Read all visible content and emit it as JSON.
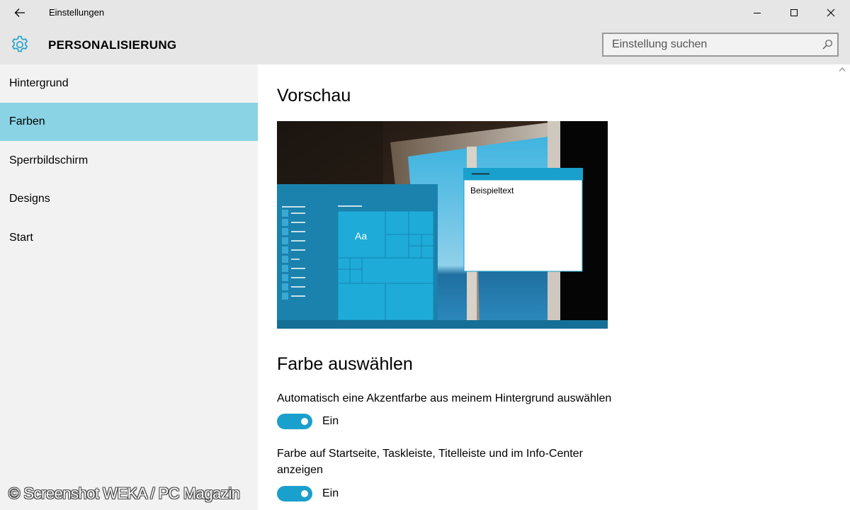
{
  "window": {
    "title": "Einstellungen"
  },
  "header": {
    "title": "PERSONALISIERUNG",
    "icon": "gear-icon",
    "accent_color": "#1aa0cc"
  },
  "search": {
    "placeholder": "Einstellung suchen",
    "icon": "search-icon"
  },
  "sidebar": {
    "items": [
      {
        "label": "Hintergrund",
        "active": false
      },
      {
        "label": "Farben",
        "active": true
      },
      {
        "label": "Sperrbildschirm",
        "active": false
      },
      {
        "label": "Designs",
        "active": false
      },
      {
        "label": "Start",
        "active": false
      }
    ],
    "active_color": "#8ad3e4"
  },
  "main": {
    "preview_heading": "Vorschau",
    "preview": {
      "tile_text": "Aa",
      "window_text": "Beispieltext"
    },
    "color_heading": "Farbe auswählen",
    "settings": [
      {
        "label": "Automatisch eine Akzentfarbe aus meinem Hintergrund auswählen",
        "state": "Ein"
      },
      {
        "label": "Farbe auf Startseite, Taskleiste, Titelleiste und im Info-Center anzeigen",
        "state": "Ein"
      }
    ]
  },
  "watermark": "© Screenshot WEKA / PC Magazin"
}
